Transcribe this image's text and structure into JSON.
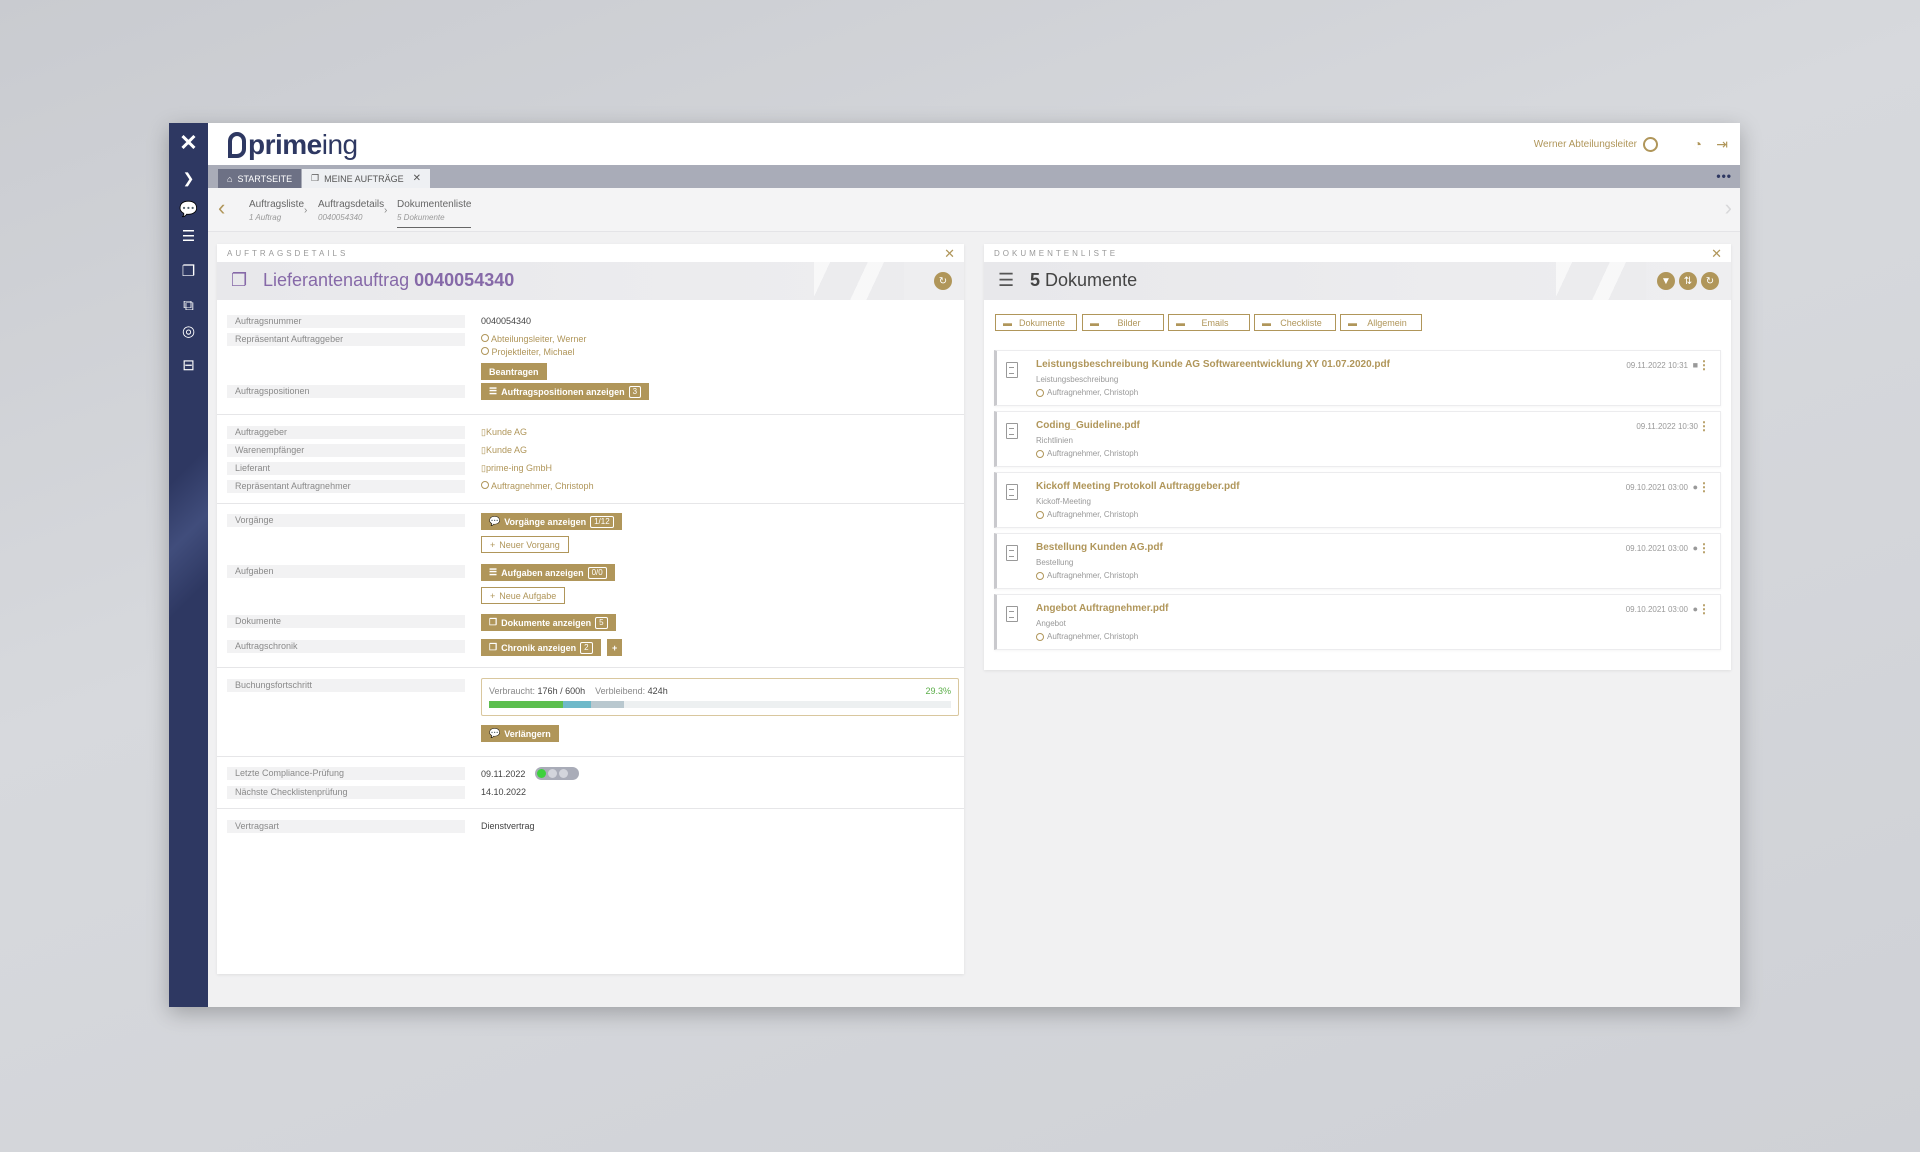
{
  "app": {
    "user_name": "Werner Abteilungsleiter"
  },
  "tabs": [
    {
      "label": "STARTSEITE"
    },
    {
      "label": "MEINE AUFTRÄGE"
    }
  ],
  "breadcrumb": [
    {
      "label": "Auftragsliste",
      "sub": "1 Auftrag"
    },
    {
      "label": "Auftragsdetails",
      "sub": "0040054340"
    },
    {
      "label": "Dokumentenliste",
      "sub": "5 Dokumente"
    }
  ],
  "details": {
    "panel_title": "AUFTRAGSDETAILS",
    "header_prefix": "Lieferantenauftrag",
    "header_number": "0040054340",
    "labels": {
      "auftragsnummer": "Auftragsnummer",
      "rep_auftraggeber": "Repräsentant Auftraggeber",
      "auftragspositionen": "Auftragspositionen",
      "auftraggeber": "Auftraggeber",
      "warenempfaenger": "Warenempfänger",
      "lieferant": "Lieferant",
      "rep_auftragnehmer": "Repräsentant Auftragnehmer",
      "vorgaenge": "Vorgänge",
      "aufgaben": "Aufgaben",
      "dokumente": "Dokumente",
      "auftragschronik": "Auftragschronik",
      "buchungsfortschritt": "Buchungsfortschritt",
      "compliance": "Letzte Compliance-Prüfung",
      "checkliste": "Nächste Checklistenprüfung",
      "vertragsart": "Vertragsart"
    },
    "values": {
      "auftragsnummer": "0040054340",
      "rep_auftraggeber_1": "Abteilungsleiter, Werner",
      "rep_auftraggeber_2": "Projektleiter, Michael",
      "auftraggeber": "Kunde AG",
      "warenempfaenger": "Kunde AG",
      "lieferant": "prime-ing GmbH",
      "rep_auftragnehmer": "Auftragnehmer, Christoph",
      "compliance_date": "09.11.2022",
      "checkliste_date": "14.10.2022",
      "vertragsart": "Dienstvertrag"
    },
    "buttons": {
      "beantragen": "Beantragen",
      "positionen": "Auftragspositionen anzeigen",
      "positionen_count": "3",
      "vorgaenge": "Vorgänge anzeigen",
      "vorgaenge_count": "1/12",
      "neuer_vorgang": "Neuer Vorgang",
      "aufgaben": "Aufgaben anzeigen",
      "aufgaben_count": "0/0",
      "neue_aufgabe": "Neue Aufgabe",
      "dokumente": "Dokumente anzeigen",
      "dokumente_count": "5",
      "chronik": "Chronik anzeigen",
      "chronik_count": "2",
      "verlaengern": "Verlängern"
    },
    "progress": {
      "used_label": "Verbraucht:",
      "used_value": "176h / 600h",
      "remaining_label": "Verbleibend:",
      "remaining_value": "424h",
      "percent_text": "29.3%",
      "segments": [
        {
          "fraction": 0.16,
          "color": "#5cbf4f"
        },
        {
          "fraction": 0.06,
          "color": "#6fb9c9"
        },
        {
          "fraction": 0.073,
          "color": "#b9c8cf"
        }
      ]
    },
    "compliance_toggle_active": 1
  },
  "documents": {
    "panel_title": "DOKUMENTENLISTE",
    "count": "5",
    "header_label": "Dokumente",
    "filters": [
      {
        "label": "Dokumente"
      },
      {
        "label": "Bilder"
      },
      {
        "label": "Emails"
      },
      {
        "label": "Checkliste"
      },
      {
        "label": "Allgemein"
      }
    ],
    "items": [
      {
        "name": "Leistungsbeschreibung Kunde AG Softwareentwicklung XY 01.07.2020.pdf",
        "category": "Leistungsbeschreibung",
        "user": "Auftragnehmer, Christoph",
        "date": "09.11.2022 10:31",
        "status": "■"
      },
      {
        "name": "Coding_Guideline.pdf",
        "category": "Richtlinien",
        "user": "Auftragnehmer, Christoph",
        "date": "09.11.2022 10:30",
        "status": ""
      },
      {
        "name": "Kickoff Meeting Protokoll Auftraggeber.pdf",
        "category": "Kickoff-Meeting",
        "user": "Auftragnehmer, Christoph",
        "date": "09.10.2021 03:00",
        "status": "●"
      },
      {
        "name": "Bestellung Kunden AG.pdf",
        "category": "Bestellung",
        "user": "Auftragnehmer, Christoph",
        "date": "09.10.2021 03:00",
        "status": "●"
      },
      {
        "name": "Angebot Auftragnehmer.pdf",
        "category": "Angebot",
        "user": "Auftragnehmer, Christoph",
        "date": "09.10.2021 03:00",
        "status": "●"
      }
    ]
  }
}
